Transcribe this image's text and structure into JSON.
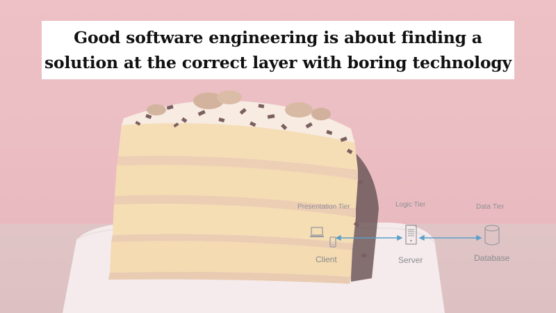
{
  "headline": {
    "line1": "Good software engineering is about finding a",
    "line2": "solution at the correct layer with boring technology"
  },
  "architecture": {
    "tiers": [
      {
        "label": "Presentation Tier"
      },
      {
        "label": "Logic Tier"
      },
      {
        "label": "Data Tier"
      }
    ],
    "nodes": [
      {
        "label": "Client",
        "icon": "client-devices-icon"
      },
      {
        "label": "Server",
        "icon": "server-icon"
      },
      {
        "label": "Database",
        "icon": "database-icon"
      }
    ],
    "connector_color": "#5a9fc8"
  },
  "colors": {
    "background_wall": "#e9b7bb",
    "headline_box": "#ffffff",
    "headline_text": "#111111",
    "diagram_gray": "#8a8a90"
  }
}
